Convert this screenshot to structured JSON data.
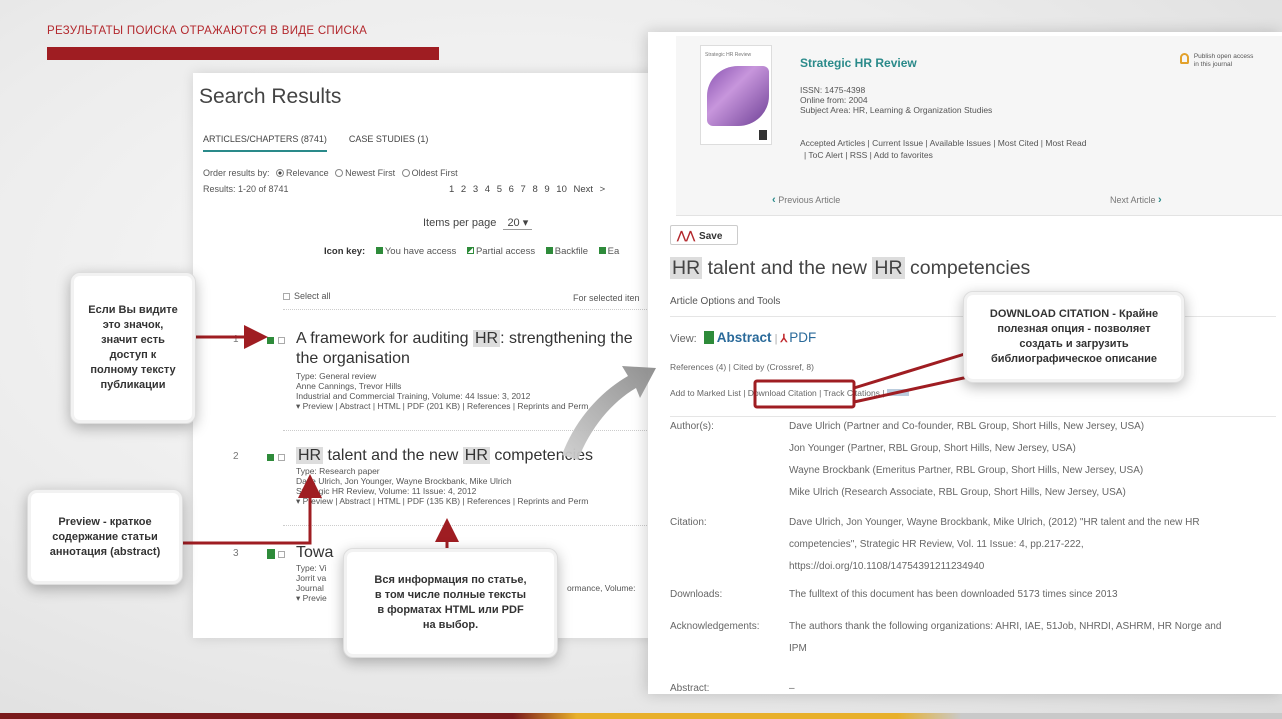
{
  "slide": {
    "title": "РЕЗУЛЬТАТЫ ПОИСКА ОТРАЖАЮТСЯ В ВИДЕ СПИСКА"
  },
  "left": {
    "heading": "Search Results",
    "tabs": [
      "ARTICLES/CHAPTERS (8741)",
      "CASE STUDIES (1)"
    ],
    "order_label": "Order results by:",
    "order_options": [
      "Relevance",
      "Newest First",
      "Oldest First"
    ],
    "results": "Results: 1-20 of 8741",
    "pages": "1  2  3  4  5  6  7  8  9  10  Next >",
    "per_page_label": "Items per page",
    "per_page_value": "20  ▾",
    "icon_key_label": "Icon key:",
    "icon_key_items": [
      "You have access",
      "Partial access",
      "Backfile",
      "Ea"
    ],
    "select_all": "Select all",
    "for_selected": "For selected iten",
    "items": [
      {
        "num": "1",
        "title_a": "A framework for auditing ",
        "title_hl": "HR",
        "title_b": ": strengthening the",
        "title_c": "the organisation",
        "type": "Type: General review",
        "authors": "Anne Cannings, Trevor Hills",
        "journal": "Industrial and Commercial Training, Volume: 44 Issue: 3, 2012",
        "links": "▾ Preview | Abstract | HTML | PDF (201 KB) | References | Reprints and Perm"
      },
      {
        "num": "2",
        "title_hl": "HR",
        "title_a": " talent and the new ",
        "title_hl2": "HR",
        "title_b": " competencies",
        "type": "Type: Research paper",
        "authors": "Dave Ulrich, Jon Younger, Wayne Brockbank, Mike Ulrich",
        "journal": "Strategic HR Review, Volume: 11 Issue: 4, 2012",
        "links": "▾ Preview | Abstract | HTML | PDF (135 KB) | References | Reprints and Perm"
      },
      {
        "num": "3",
        "title": "Towa",
        "type": "Type: Vi",
        "authors": "Jorrit va",
        "journal": "Journal",
        "journal_tail": "ormance, Volume:",
        "links": "▾ Previe"
      }
    ]
  },
  "right": {
    "journal_name": "Strategic HR Review",
    "cover_title": "Strategic HR Review",
    "open_access": [
      "Publish open access",
      "in this journal"
    ],
    "issn": "ISSN: 1475-4398",
    "online": "Online from: 2004",
    "subject": "Subject Area: HR, Learning & Organization Studies",
    "journal_links_1": "Accepted Articles | Current Issue | Available Issues | Most Cited | Most Read",
    "journal_links_2": "| ToC Alert | RSS | Add to favorites",
    "prev": "Previous Article",
    "next": "Next Article",
    "save": "Save",
    "title_hl": "HR",
    "title_a": " talent and the new ",
    "title_hl2": "HR",
    "title_b": " competencies",
    "options": "Article Options and Tools",
    "view_label": "View:",
    "abstract": "Abstract",
    "pdf": "PDF",
    "refs": "References (4) | Cited by (Crossref, 8)",
    "actions": "Add to Marked List | Download Citation | Track Citations | ",
    "author_label": "Author(s):",
    "authors": [
      "Dave Ulrich (Partner and Co-founder, RBL Group, Short Hills, New Jersey, USA)",
      "Jon Younger (Partner, RBL Group, Short Hills, New Jersey, USA)",
      "Wayne Brockbank (Emeritus Partner, RBL Group, Short Hills, New Jersey, USA)",
      "Mike Ulrich (Research Associate, RBL Group, Short Hills, New Jersey, USA)"
    ],
    "citation_label": "Citation:",
    "citation": [
      "Dave Ulrich, Jon Younger, Wayne Brockbank, Mike Ulrich, (2012) \"HR talent and the new HR",
      "competencies\", Strategic HR Review, Vol. 11 Issue: 4, pp.217-222,",
      "https://doi.org/10.1108/14754391211234940"
    ],
    "downloads_label": "Downloads:",
    "downloads": "The fulltext of this document has been downloaded 5173 times since 2013",
    "ack_label": "Acknowledgements:",
    "ack": [
      "The authors thank the following organizations: AHRI, IAE, 51Job, NHRDI, ASHRM, HR Norge and",
      "IPM"
    ],
    "abstract_label": "Abstract:",
    "abstract_dash": "–"
  },
  "callouts": {
    "access": [
      "Если Вы видите",
      "это значок,",
      "значит есть",
      "доступ к",
      "полному тексту",
      "публикации"
    ],
    "preview": [
      "Preview  - краткое",
      "содержание статьи",
      "аннотация (abstract)"
    ],
    "info": [
      "Вся информация по статье,",
      "в том числе полные тексты",
      "в форматах HTML или PDF",
      "на выбор."
    ],
    "citation": [
      "DOWNLOAD CITATION  - Крайне",
      "полезная опция - позволяет",
      "создать и загрузить",
      "библиографическое описание"
    ]
  },
  "colors": {
    "accent_red": "#9f1d22",
    "link_teal": "#2a8a8a",
    "access_green": "#2e8b3a"
  }
}
